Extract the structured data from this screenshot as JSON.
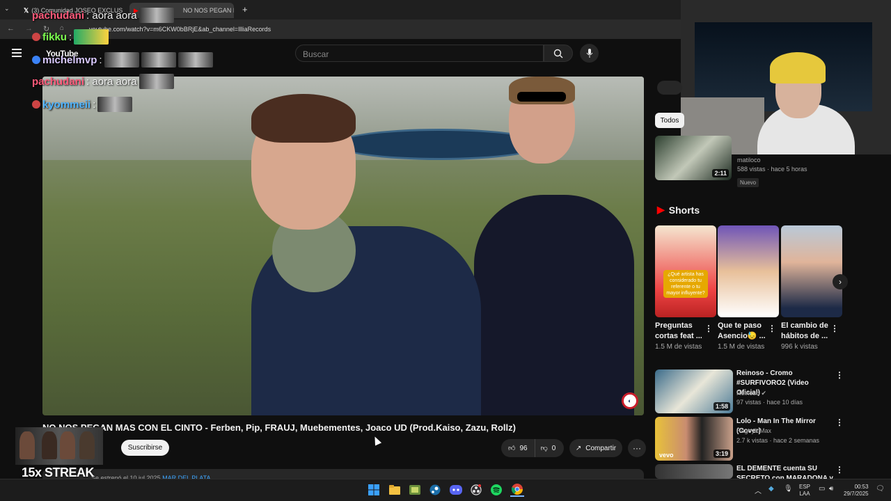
{
  "browser": {
    "tabs": [
      {
        "label": "(3) Comunidad JOSEO EXCLUS",
        "icon": "x-logo-icon"
      },
      {
        "label": "NO NOS PEGAN MAS CON",
        "icon": "youtube-icon"
      }
    ],
    "url": "youtube.com/watch?v=m6CKW0bBRjE&ab_channel=IlliaRecords"
  },
  "youtube": {
    "logo": "YouTube",
    "search_placeholder": "Buscar"
  },
  "video": {
    "title": "NO NOS PEGAN MAS CON EL CINTO - Ferben, Pip, FRAUJ, Muebementes, Joaco UD (Prod.Kaiso, Zazu, Rollz)",
    "subscribe_label": "Suscribirse",
    "likes": "96",
    "dislikes": "0",
    "share_label": "Compartir",
    "more_label": "···",
    "desc_text": "Se estrenó el 10 jul 2025",
    "desc_link": "MAR DEL PLATA"
  },
  "overlay": {
    "streak": "15x STREAK",
    "chat": [
      {
        "user": "pachudani",
        "message": ": aora aora",
        "color": "#ff5a7a"
      },
      {
        "user": "fikku",
        "message": ":",
        "color": "#7cff4f"
      },
      {
        "user": "michelmvp",
        "message": ":",
        "color": "#d9c9ff"
      },
      {
        "user": "pachudani",
        "message": ": aora aora",
        "color": "#ff5a7a"
      },
      {
        "user": "kyommeii",
        "message": ":",
        "color": "#4fb4ff"
      }
    ]
  },
  "sidebar": {
    "chip_all": "Todos",
    "rec1": {
      "channel": "matiloco",
      "meta": "588 vistas · hace 5 horas",
      "badge": "Nuevo",
      "duration": "2:11"
    },
    "shorts_label": "Shorts",
    "shorts": [
      {
        "title": "Preguntas cortas feat ...",
        "views": "1.5 M de vistas",
        "caption": "¿Qué artista has considerado tu referente o tu mayor influyente?"
      },
      {
        "title": "Que te paso Asencio😓 ...",
        "views": "1.5 M de vistas"
      },
      {
        "title": "El cambio de hábitos de ...",
        "views": "996 k vistas"
      }
    ],
    "videos": [
      {
        "title": "Reinoso - Cromo #SURFIVORO2 (Video Oficial)",
        "channel": "Reinoso",
        "meta": "97 vistas · hace 10 días",
        "duration": "1:58"
      },
      {
        "title": "Lolo - Man In The Mirror (Cover)",
        "channel": "RageyloMax",
        "meta": "2.7 k vistas · hace 2 semanas",
        "duration": "3:19",
        "thumb_label": "vevo"
      },
      {
        "title": "EL DEMENTE cuenta SU SECRETO con MARADONA y ...",
        "channel": "",
        "meta": "",
        "duration": ""
      }
    ]
  },
  "taskbar": {
    "lang_top": "ESP",
    "lang_bottom": "LAA",
    "time": "00:53",
    "date": "29/7/2025"
  }
}
